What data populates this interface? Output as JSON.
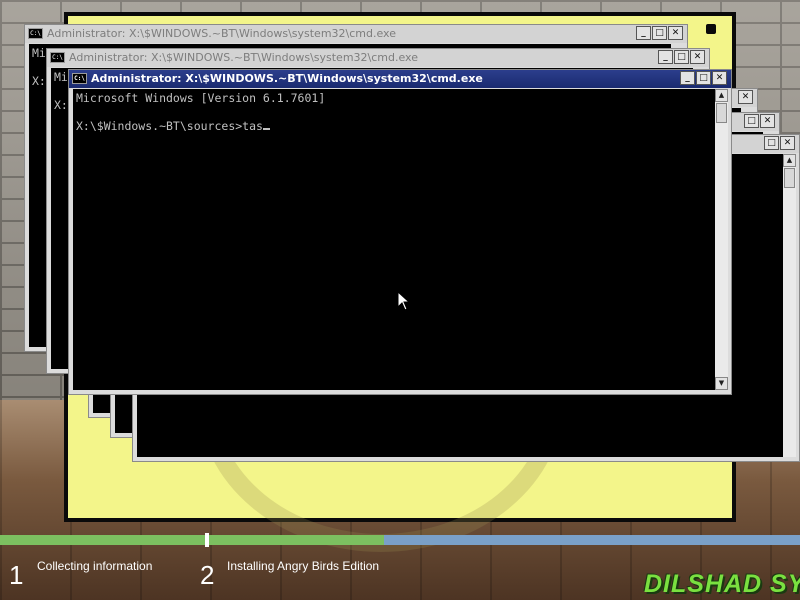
{
  "windows": {
    "back1": {
      "title": "Administrator: X:\\$WINDOWS.~BT\\Windows\\system32\\cmd.exe",
      "line1": "Mi",
      "line2": "X:"
    },
    "back2": {
      "title": "Administrator: X:\\$WINDOWS.~BT\\Windows\\system32\\cmd.exe",
      "line1": "Mi",
      "line2": "X:"
    },
    "active": {
      "title": "Administrator: X:\\$WINDOWS.~BT\\Windows\\system32\\cmd.exe",
      "version_line": "Microsoft Windows [Version 6.1.7601]",
      "prompt_line": "X:\\$Windows.~BT\\sources>tas"
    }
  },
  "icon_label": "C:\\",
  "buttons": {
    "minimize": "_",
    "maximize": "□",
    "close": "✕"
  },
  "scroll": {
    "up": "▲",
    "down": "▼"
  },
  "setup": {
    "progress_fraction": 0.48,
    "steps": [
      {
        "number": "1",
        "label": "Collecting information"
      },
      {
        "number": "2",
        "label": "Installing Angry Birds Edition"
      }
    ]
  },
  "brand": "DILSHAD SYS",
  "colors": {
    "title_active": "#1f2f78",
    "console_bg": "#000000",
    "board": "#f3f58a",
    "progress_done": "#7cc060",
    "progress_todo": "#7aa0c8"
  }
}
